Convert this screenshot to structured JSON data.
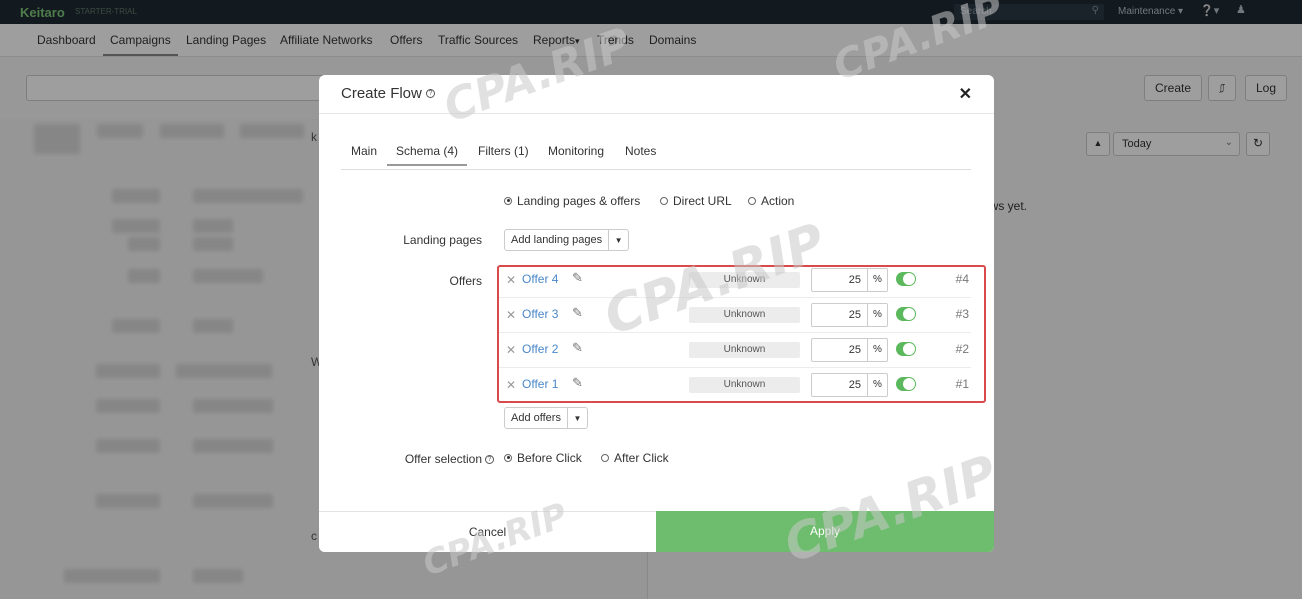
{
  "topbar": {
    "brand": "Keitaro",
    "plan": "STARTER-TRIAL",
    "search_placeholder": "Search",
    "maintenance": "Maintenance",
    "colors": {
      "bg": "#1f2a33",
      "brand": "#7fc97a"
    }
  },
  "nav": {
    "items": [
      "Dashboard",
      "Campaigns",
      "Landing Pages",
      "Affiliate Networks",
      "Offers",
      "Traffic Sources",
      "Reports",
      "Trends",
      "Domains"
    ],
    "active": "Campaigns"
  },
  "background": {
    "create_label": "Create",
    "log_label": "Log",
    "date_range": "Today",
    "no_flows_text": "ows yet.",
    "fragments": [
      "k",
      "W",
      "c"
    ]
  },
  "modal": {
    "title": "Create Flow",
    "tabs": [
      "Main",
      "Schema (4)",
      "Filters (1)",
      "Monitoring",
      "Notes"
    ],
    "active_tab": "Schema (4)",
    "schema_types": [
      "Landing pages & offers",
      "Direct URL",
      "Action"
    ],
    "schema_selected": "Landing pages & offers",
    "landing_pages_label": "Landing pages",
    "add_landing_pages_label": "Add landing pages",
    "offers_label": "Offers",
    "offers": [
      {
        "name": "Offer 4",
        "status": "Unknown",
        "share": "25",
        "unit": "%",
        "enabled": true,
        "index": "#4"
      },
      {
        "name": "Offer 3",
        "status": "Unknown",
        "share": "25",
        "unit": "%",
        "enabled": true,
        "index": "#3"
      },
      {
        "name": "Offer 2",
        "status": "Unknown",
        "share": "25",
        "unit": "%",
        "enabled": true,
        "index": "#2"
      },
      {
        "name": "Offer 1",
        "status": "Unknown",
        "share": "25",
        "unit": "%",
        "enabled": true,
        "index": "#1"
      }
    ],
    "add_offers_label": "Add offers",
    "offer_selection_label": "Offer selection",
    "offer_selection_options": [
      "Before Click",
      "After Click"
    ],
    "offer_selection_selected": "Before Click",
    "cancel_label": "Cancel",
    "apply_label": "Apply",
    "colors": {
      "apply": "#6ebd6e",
      "highlight": "#d94a4a",
      "link": "#4a88c7",
      "toggle_on": "#5cb85c"
    }
  },
  "watermark": "CPA.RIP"
}
